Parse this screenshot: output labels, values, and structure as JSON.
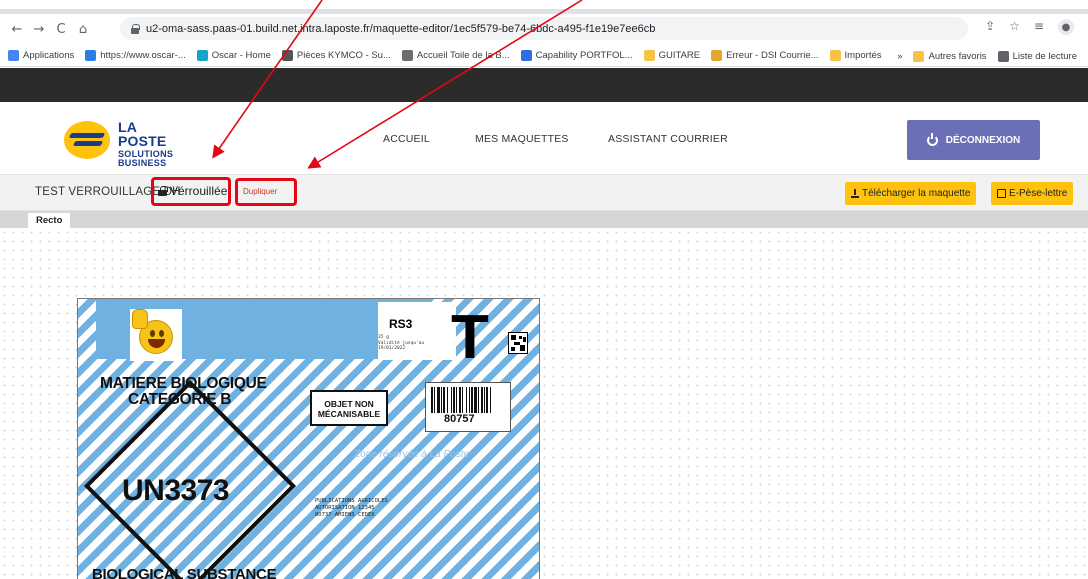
{
  "browser": {
    "url": "u2-oma-sass.paas-01.build.net.intra.laposte.fr/maquette-editor/1ec5f579-be74-6bdc-a495-f1e19e7ee6cb",
    "nav": {
      "back": "←",
      "forward": "→",
      "reload": "C",
      "home": "⌂"
    },
    "bookmarks": [
      {
        "label": "Applications",
        "color": "#4285f4"
      },
      {
        "label": "https://www.oscar-...",
        "color": "#2a7de1"
      },
      {
        "label": "Oscar - Home",
        "color": "#1aa3c4"
      },
      {
        "label": "Pièces KYMCO - Su...",
        "color": "#555555"
      },
      {
        "label": "Accueil Toile de la B...",
        "color": "#6d6d6d"
      },
      {
        "label": "Capability PORTFOL...",
        "color": "#2f6de1"
      },
      {
        "label": "GUITARE",
        "color": "#f6c343"
      },
      {
        "label": "Erreur - DSI Courrie...",
        "color": "#e0a82e"
      },
      {
        "label": "Importés",
        "color": "#f6c343"
      }
    ],
    "bookmarks_right": [
      {
        "label": "»",
        "color": ""
      },
      {
        "label": "Autres favoris",
        "color": "#f6c343"
      },
      {
        "label": "Liste de lecture",
        "color": "#5f6368"
      }
    ]
  },
  "header": {
    "logo_line1": "LA POSTE",
    "logo_line2": "SOLUTIONS",
    "logo_line3": "BUSINESS",
    "nav_items": [
      "ACCUEIL",
      "MES MAQUETTES",
      "ASSISTANT COURRIER"
    ],
    "logout_label": "DÉCONNEXION",
    "logout_color": "#6b6fb8"
  },
  "toolbar": {
    "doc_title": "TEST VERROUILLAGE DH",
    "locked_label": "Vérrouillée",
    "duplicate_label": "Dupliquer",
    "download_label": "Télécharger la maquette",
    "pese_lettre_label": "E-Pèse-lettre",
    "button_color": "#ffc20e",
    "highlight_color": "#e30613"
  },
  "tabs": {
    "recto": "Recto"
  },
  "envelope": {
    "rs3": "RS3",
    "rs3_sub": [
      "35 g",
      "Validité jusqu'au",
      "19/01/2022"
    ],
    "t_mark": "T",
    "mat_line1": "MATIERE BIOLOGIQUE",
    "mat_line2": "CATEGORIE B",
    "objet_non": "OBJET NON",
    "mecanisable": "MÉCANISABLE",
    "barcode_number": "80757",
    "un_code": "UN3373",
    "faint_text": "Zone réservée à La Poste",
    "publi_lines": [
      "PUBLICATIONS AGRICOLES",
      "AUTORISATION 12345",
      "80737 AMIENS CEDEX"
    ],
    "bio_text": "BIOLOGICAL SUBSTANCE",
    "stripe_color": "#6fb1e1"
  }
}
